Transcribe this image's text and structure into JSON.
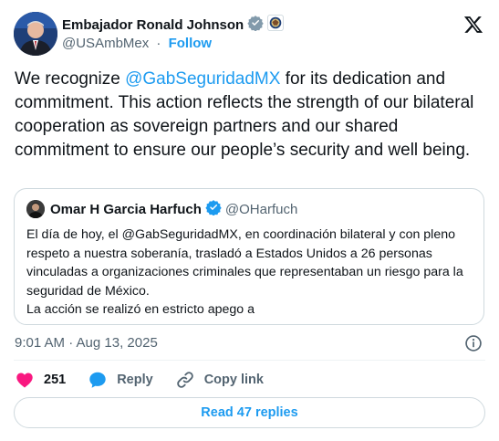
{
  "author": {
    "name": "Embajador Ronald Johnson",
    "handle": "@USAmbMex",
    "separator": "·",
    "follow_label": "Follow",
    "icons": [
      "verified-badge-icon",
      "embassy-seal-icon"
    ]
  },
  "tweet": {
    "text_before": "We recognize ",
    "mention": "@GabSeguridadMX",
    "text_after": " for its dedication and commitment.  This action reflects the strength of our bilateral cooperation as sovereign partners and our shared commitment to ensure our people’s security and well being."
  },
  "quote": {
    "name": "Omar H Garcia Harfuch",
    "handle": "@OHarfuch",
    "text_1": "El día de hoy, el @GabSeguridadMX, en coordinación bilateral y con pleno respeto a nuestra soberanía, trasladó a Estados Unidos a 26 personas vinculadas a organizaciones criminales que representaban un riesgo para la seguridad de México.",
    "text_2": "La acción se realizó en estricto apego a"
  },
  "timestamp": "9:01 AM · Aug 13, 2025",
  "actions": {
    "like_count": "251",
    "reply_label": "Reply",
    "copy_link_label": "Copy link"
  },
  "read_replies_label": "Read 47 replies",
  "colors": {
    "accent": "#1d9bf0",
    "like": "#f91880",
    "muted": "#536471",
    "border": "#cfd9de"
  }
}
